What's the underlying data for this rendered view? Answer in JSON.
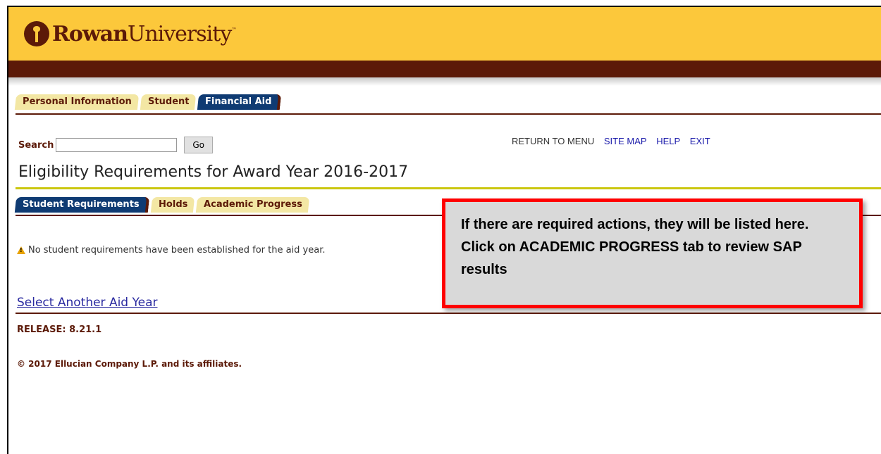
{
  "header": {
    "brand_bold": "Rowan",
    "brand_regular": "University",
    "brand_tm": "™"
  },
  "top_tabs": [
    {
      "label": "Personal Information",
      "active": false
    },
    {
      "label": "Student",
      "active": false
    },
    {
      "label": "Financial Aid",
      "active": true
    }
  ],
  "search": {
    "label": "Search",
    "value": "",
    "button": "Go"
  },
  "nav_links": {
    "return_to_menu": "RETURN TO MENU",
    "site_map": "SITE MAP",
    "help": "HELP",
    "exit": "EXIT"
  },
  "page": {
    "title": "Eligibility Requirements for Award Year 2016-2017"
  },
  "sub_tabs": [
    {
      "label": "Student Requirements",
      "active": true
    },
    {
      "label": "Holds",
      "active": false
    },
    {
      "label": "Academic Progress",
      "active": false
    }
  ],
  "content": {
    "notice": "No student requirements have been established for the aid year.",
    "select_link": "Select Another Aid Year",
    "release": "RELEASE: 8.21.1",
    "copyright": "© 2017 Ellucian Company L.P. and its affiliates."
  },
  "callout": {
    "text": "If there are required actions, they will be listed here. Click on ACADEMIC PROGRESS tab to review SAP results"
  },
  "colors": {
    "gold": "#fcc83b",
    "maroon": "#5c1a08",
    "active_tab": "#0f3b73",
    "inactive_tab": "#f3e7a4",
    "callout_border": "#ff0000"
  },
  "icons": [
    "torch-logo-icon",
    "warning-icon"
  ]
}
